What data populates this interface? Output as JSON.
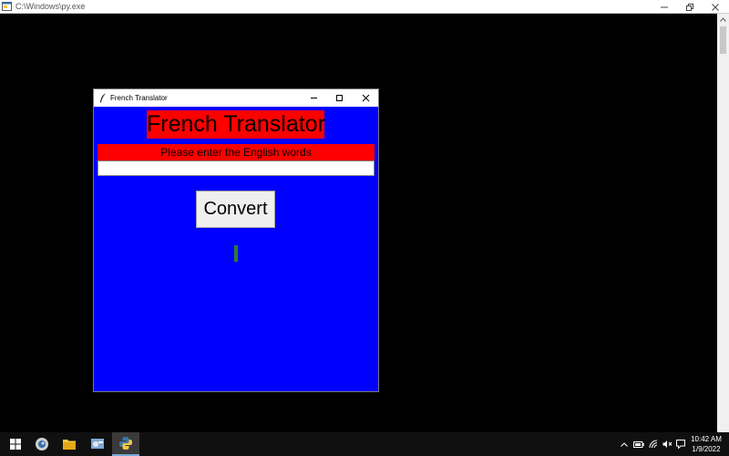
{
  "console": {
    "title": "C:\\Windows\\py.exe",
    "icons": {
      "app": "console-icon",
      "minimize": "minimize-icon",
      "restore": "restore-icon",
      "close": "close-icon"
    }
  },
  "app": {
    "title": "French Translator",
    "heading": "French Translator",
    "prompt": "Please enter the English words",
    "input": {
      "value": "",
      "placeholder": ""
    },
    "convert_label": "Convert",
    "result": "",
    "colors": {
      "background": "#0000ff",
      "label": "#ff0000",
      "result": "#2e7d32"
    }
  },
  "taskbar": {
    "items": [
      "windows-start",
      "edge-browser",
      "file-explorer",
      "control-panel",
      "python-console"
    ],
    "clock": {
      "time": "10:42 AM",
      "date": "1/9/2022"
    }
  }
}
